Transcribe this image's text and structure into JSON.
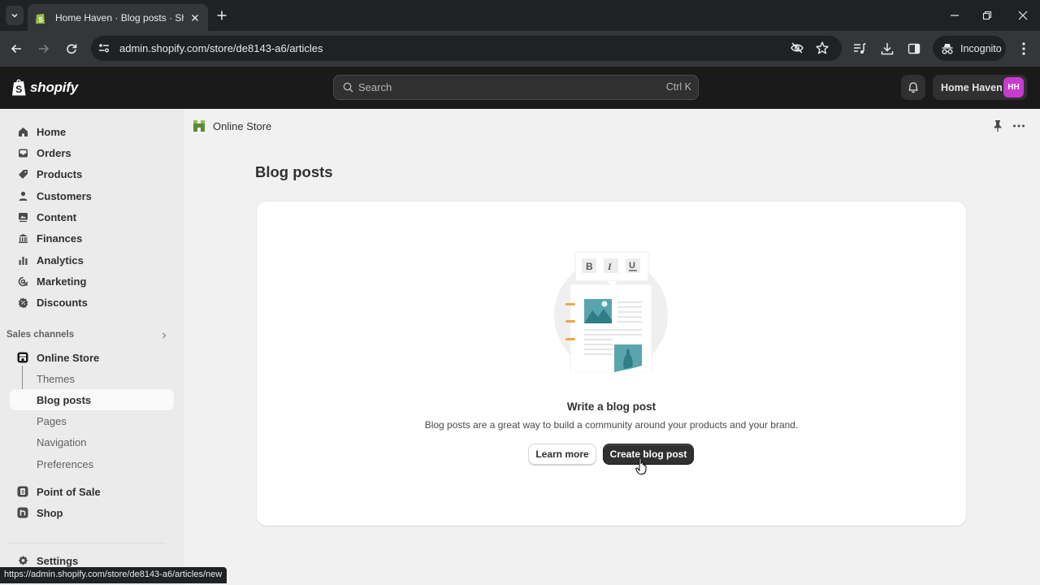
{
  "browser": {
    "tab_title": "Home Haven · Blog posts · Shopify",
    "url": "admin.shopify.com/store/de8143-a6/articles",
    "incognito_label": "Incognito",
    "status_url": "https://admin.shopify.com/store/de8143-a6/articles/new"
  },
  "topbar": {
    "logo_text": "shopify",
    "search_placeholder": "Search",
    "search_shortcut": "Ctrl K",
    "store_name": "Home Haven",
    "avatar_initials": "HH",
    "avatar_color": "#c83bd0"
  },
  "sidebar": {
    "items": [
      {
        "label": "Home",
        "icon": "home-icon"
      },
      {
        "label": "Orders",
        "icon": "inbox-icon"
      },
      {
        "label": "Products",
        "icon": "tag-icon"
      },
      {
        "label": "Customers",
        "icon": "person-icon"
      },
      {
        "label": "Content",
        "icon": "image-icon"
      },
      {
        "label": "Finances",
        "icon": "bank-icon"
      },
      {
        "label": "Analytics",
        "icon": "bar-chart-icon"
      },
      {
        "label": "Marketing",
        "icon": "target-icon"
      },
      {
        "label": "Discounts",
        "icon": "discount-icon"
      }
    ],
    "sales_channels_label": "Sales channels",
    "online_store": {
      "label": "Online Store",
      "sub_items": [
        {
          "label": "Themes",
          "active": false
        },
        {
          "label": "Blog posts",
          "active": true
        },
        {
          "label": "Pages",
          "active": false
        },
        {
          "label": "Navigation",
          "active": false
        },
        {
          "label": "Preferences",
          "active": false
        }
      ]
    },
    "point_of_sale_label": "Point of Sale",
    "shop_label": "Shop",
    "settings_label": "Settings"
  },
  "main": {
    "breadcrumb": "Online Store",
    "page_title": "Blog posts",
    "empty_state": {
      "title": "Write a blog post",
      "description": "Blog posts are a great way to build a community around your products and your brand.",
      "secondary_action": "Learn more",
      "primary_action": "Create blog post",
      "toolbar_letters": [
        "B",
        "I",
        "U"
      ]
    }
  }
}
